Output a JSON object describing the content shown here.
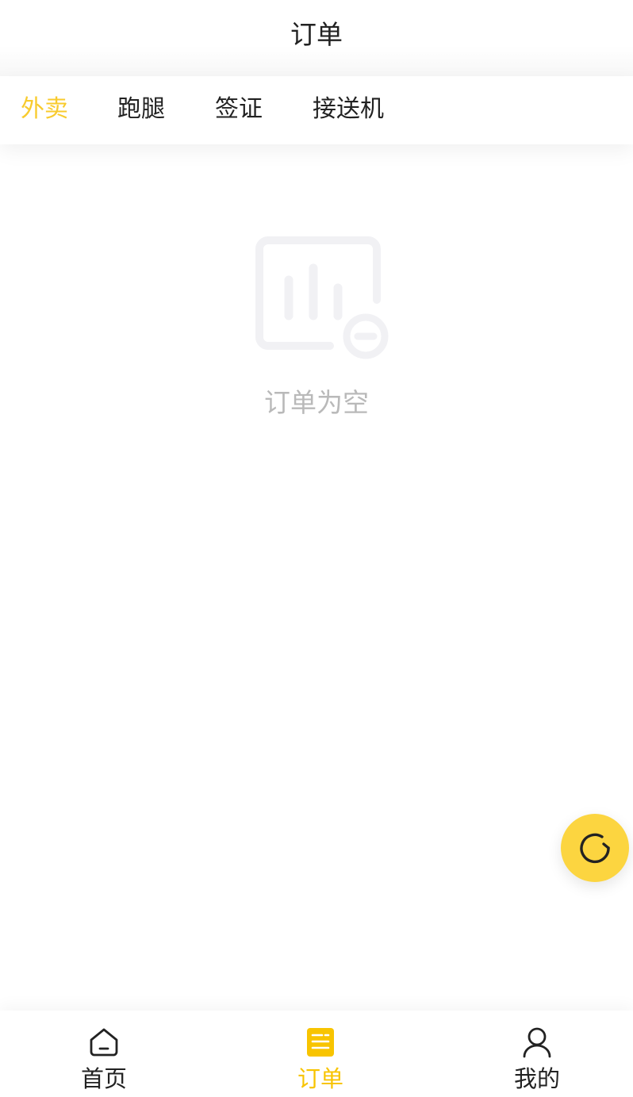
{
  "header": {
    "title": "订单"
  },
  "tabs": [
    {
      "label": "外卖",
      "active": true
    },
    {
      "label": "跑腿",
      "active": false
    },
    {
      "label": "签证",
      "active": false
    },
    {
      "label": "接送机",
      "active": false
    }
  ],
  "empty_state": {
    "icon": "empty-chart-icon",
    "text": "订单为空"
  },
  "refresh_button": {
    "icon": "refresh-icon"
  },
  "bottom_nav": {
    "items": [
      {
        "label": "首页",
        "icon": "home-icon",
        "active": false
      },
      {
        "label": "订单",
        "icon": "order-icon",
        "active": true
      },
      {
        "label": "我的",
        "icon": "user-icon",
        "active": false
      }
    ]
  },
  "colors": {
    "accent": "#f8cb2e",
    "nav_active": "#f8c400",
    "refresh_bg": "#fcd540",
    "text_primary": "#222222",
    "text_muted": "#b9b9b9",
    "empty_icon": "#f1f1f4"
  }
}
